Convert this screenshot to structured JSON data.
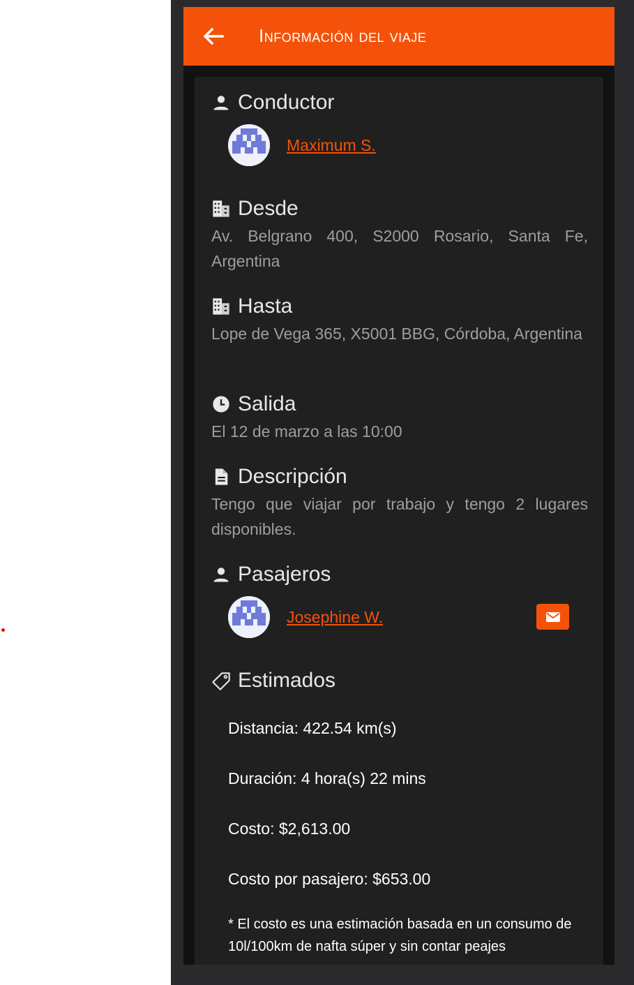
{
  "header": {
    "title": "Información del viaje",
    "back_icon": "arrow-left-icon"
  },
  "driver": {
    "heading": "Conductor",
    "icon": "person-icon",
    "name": "Maximum S."
  },
  "from": {
    "heading": "Desde",
    "icon": "building-icon",
    "address": "Av. Belgrano 400, S2000 Rosario, Santa Fe, Argentina"
  },
  "to": {
    "heading": "Hasta",
    "icon": "building-icon",
    "address": "Lope de Vega 365, X5001 BBG, Córdoba, Argentina"
  },
  "departure": {
    "heading": "Salida",
    "icon": "clock-icon",
    "value": "El 12 de marzo a las 10:00"
  },
  "description": {
    "heading": "Descripción",
    "icon": "document-icon",
    "text": "Tengo que viajar por trabajo y tengo 2 lugares disponibles."
  },
  "passengers": {
    "heading": "Pasajeros",
    "icon": "person-icon",
    "items": [
      {
        "name": "Josephine W.",
        "action_icon": "mail-icon"
      }
    ]
  },
  "estimates": {
    "heading": "Estimados",
    "icon": "tag-icon",
    "distance": "Distancia: 422.54 km(s)",
    "duration": "Duración: 4 hora(s) 22 mins",
    "cost": "Costo: $2,613.00",
    "cost_per_passenger": "Costo por pasajero: $653.00",
    "note": "* El costo es una estimación basada en un consumo de 10l/100km de nafta súper y sin contar peajes"
  },
  "colors": {
    "accent": "#f4520a",
    "card_bg": "#202020",
    "panel_bg": "#121212",
    "muted_text": "#9e9e9e"
  }
}
